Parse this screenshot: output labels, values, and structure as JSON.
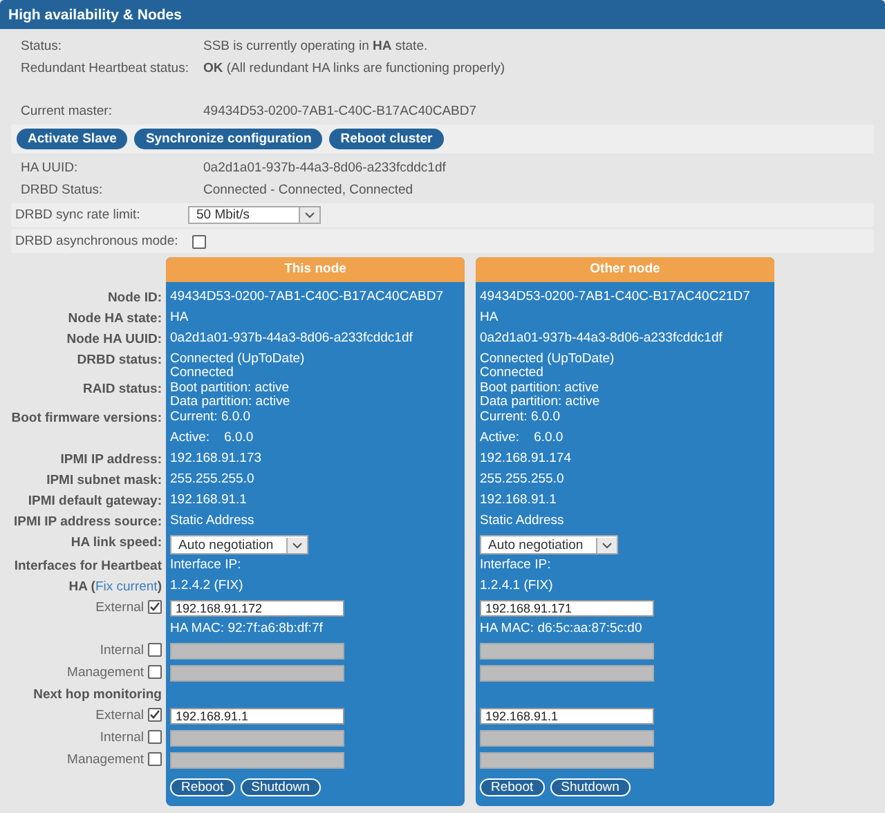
{
  "window": {
    "title": "High availability & Nodes"
  },
  "info": [
    {
      "label": "Status:",
      "value": "SSB is currently operating in **HA** state."
    },
    {
      "label": "Redundant Heartbeat status:",
      "value": "**OK** (All redundant HA links are functioning properly)"
    },
    {
      "label": "Current master:",
      "value": "49434D53-0200-7AB1-C40C-B17AC40CABD7"
    }
  ],
  "actions": [
    "Activate Slave",
    "Synchronize configuration",
    "Reboot cluster"
  ],
  "info_2": [
    {
      "label": "HA UUID:",
      "value": "0a2d1a01-937b-44a3-8d06-a233fcddc1df"
    },
    {
      "label": "DRBD Status:",
      "value": "Connected - Connected, Connected"
    }
  ],
  "settings": [
    {
      "kind": "select",
      "label": "DRBD sync rate limit:",
      "value": "50 Mbit/s"
    },
    {
      "kind": "checkbox",
      "label": "DRBD asynchronous mode:",
      "checked": false
    }
  ],
  "nodes": [
    {
      "title": "This node"
    },
    {
      "title": "Other node"
    }
  ],
  "node_rows": [
    {
      "kind": "text",
      "label": {
        "kind": "heading",
        "text": "Node ID:"
      },
      "cells": [
        {
          "lines": [
            "49434D53-0200-7AB1-C40C-B17AC40CABD7"
          ]
        },
        {
          "lines": [
            "49434D53-0200-7AB1-C40C-B17AC40C21D7"
          ]
        }
      ]
    },
    {
      "kind": "text",
      "label": {
        "kind": "heading",
        "text": "Node HA state:"
      },
      "cells": [
        {
          "lines": [
            "HA"
          ]
        },
        {
          "lines": [
            "HA"
          ]
        }
      ]
    },
    {
      "kind": "text",
      "label": {
        "kind": "heading",
        "text": "Node HA UUID:"
      },
      "cells": [
        {
          "lines": [
            "0a2d1a01-937b-44a3-8d06-a233fcddc1df"
          ]
        },
        {
          "lines": [
            "0a2d1a01-937b-44a3-8d06-a233fcddc1df"
          ]
        }
      ]
    },
    {
      "kind": "text",
      "label": {
        "kind": "heading",
        "text": "DRBD status:"
      },
      "cells": [
        {
          "lines": [
            "Connected (UpToDate)",
            "Connected"
          ]
        },
        {
          "lines": [
            "Connected (UpToDate)",
            "Connected"
          ]
        }
      ]
    },
    {
      "kind": "text",
      "label": {
        "kind": "heading",
        "text": "RAID status:"
      },
      "cells": [
        {
          "lines": [
            "Boot partition: active",
            "Data partition: active"
          ]
        },
        {
          "lines": [
            "Boot partition: active",
            "Data partition: active"
          ]
        }
      ]
    },
    {
      "kind": "text",
      "label": {
        "kind": "heading",
        "text": "Boot firmware versions:"
      },
      "cells": [
        {
          "lines": [
            "Current: 6.0.0"
          ]
        },
        {
          "lines": [
            "Current: 6.0.0"
          ]
        }
      ]
    },
    {
      "kind": "text",
      "cells": [
        {
          "lines": [
            "Active:    6.0.0"
          ]
        },
        {
          "lines": [
            "Active:    6.0.0"
          ]
        }
      ]
    },
    {
      "kind": "text",
      "label": {
        "kind": "heading",
        "text": "IPMI IP address:"
      },
      "cells": [
        {
          "lines": [
            "192.168.91.173"
          ]
        },
        {
          "lines": [
            "192.168.91.174"
          ]
        }
      ]
    },
    {
      "kind": "text",
      "label": {
        "kind": "heading",
        "text": "IPMI subnet mask:"
      },
      "cells": [
        {
          "lines": [
            "255.255.255.0"
          ]
        },
        {
          "lines": [
            "255.255.255.0"
          ]
        }
      ]
    },
    {
      "kind": "text",
      "label": {
        "kind": "heading",
        "text": "IPMI default gateway:"
      },
      "cells": [
        {
          "lines": [
            "192.168.91.1"
          ]
        },
        {
          "lines": [
            "192.168.91.1"
          ]
        }
      ]
    },
    {
      "kind": "text",
      "label": {
        "kind": "heading",
        "text": "IPMI IP address source:"
      },
      "cells": [
        {
          "lines": [
            "Static Address"
          ]
        },
        {
          "lines": [
            "Static Address"
          ]
        }
      ]
    },
    {
      "kind": "select",
      "label": {
        "kind": "heading",
        "text": "HA link speed:"
      },
      "cells": [
        {
          "value": "Auto negotiation"
        },
        {
          "value": "Auto negotiation"
        }
      ]
    },
    {
      "kind": "text",
      "label": {
        "kind": "heading",
        "text": "Interfaces for Heartbeat"
      },
      "cells": [
        {
          "lines": [
            "Interface IP:"
          ]
        },
        {
          "lines": [
            "Interface IP:"
          ]
        }
      ]
    },
    {
      "kind": "text",
      "label": {
        "kind": "link",
        "text": "HA (",
        "link": "Fix current",
        "after": ")"
      },
      "cells": [
        {
          "lines": [
            "1.2.4.2 (FIX)"
          ]
        },
        {
          "lines": [
            "1.2.4.1 (FIX)"
          ]
        }
      ]
    },
    {
      "kind": "input",
      "label": {
        "kind": "option",
        "text": "External",
        "checked": true
      },
      "cells": [
        {
          "value": "192.168.91.172",
          "disabled": false
        },
        {
          "value": "192.168.91.171",
          "disabled": false
        }
      ]
    },
    {
      "kind": "text",
      "cells": [
        {
          "lines": [
            "HA MAC: 92:7f:a6:8b:df:7f"
          ]
        },
        {
          "lines": [
            "HA MAC: d6:5c:aa:87:5c:d0"
          ]
        }
      ]
    },
    {
      "kind": "input",
      "label": {
        "kind": "option",
        "text": "Internal",
        "checked": false
      },
      "cells": [
        {
          "disabled": true
        },
        {
          "disabled": true
        }
      ]
    },
    {
      "kind": "input",
      "label": {
        "kind": "option",
        "text": "Management",
        "checked": false
      },
      "cells": [
        {
          "disabled": true
        },
        {
          "disabled": true
        }
      ]
    },
    {
      "kind": "blank",
      "label": {
        "kind": "heading",
        "text": "Next hop monitoring"
      }
    },
    {
      "kind": "input",
      "label": {
        "kind": "option",
        "text": "External",
        "checked": true
      },
      "cells": [
        {
          "value": "192.168.91.1",
          "disabled": false
        },
        {
          "value": "192.168.91.1",
          "disabled": false
        }
      ]
    },
    {
      "kind": "input",
      "label": {
        "kind": "option",
        "text": "Internal",
        "checked": false
      },
      "cells": [
        {
          "disabled": true
        },
        {
          "disabled": true
        }
      ]
    },
    {
      "kind": "input",
      "label": {
        "kind": "option",
        "text": "Management",
        "checked": false
      },
      "cells": [
        {
          "disabled": true
        },
        {
          "disabled": true
        }
      ]
    },
    {
      "kind": "buttons",
      "cells": [
        {
          "buttons": [
            "Reboot",
            "Shutdown"
          ]
        },
        {
          "buttons": [
            "Reboot",
            "Shutdown"
          ]
        }
      ]
    }
  ]
}
